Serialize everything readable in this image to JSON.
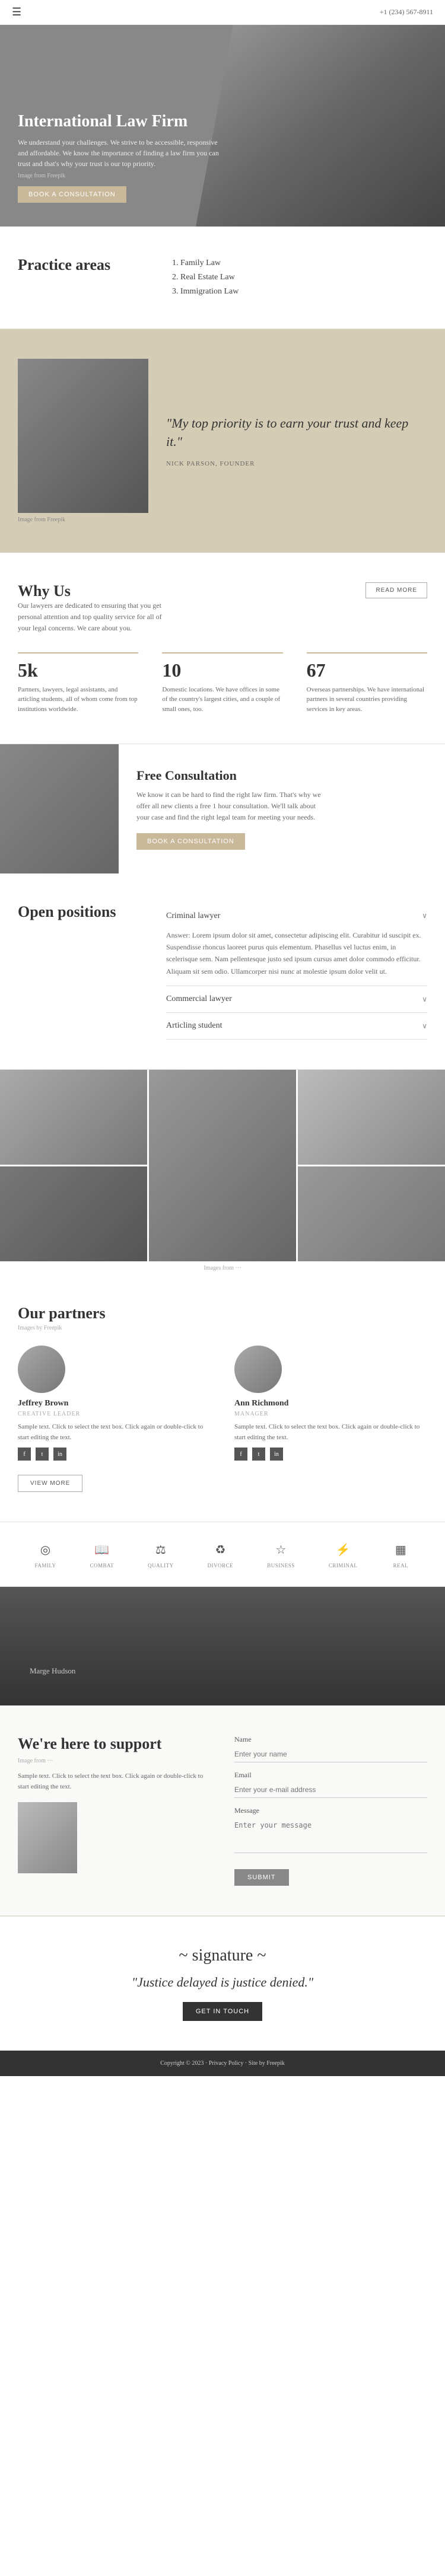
{
  "header": {
    "menu_icon": "☰",
    "phone": "+1 (234) 567-8911"
  },
  "hero": {
    "title": "International Law Firm",
    "description": "We understand your challenges. We strive to be accessible, responsive and affordable. We know the importance of finding a law firm you can trust and that's why your trust is our top priority.",
    "image_from": "Image from Freepik",
    "cta_label": "BOOK A CONSULTATION"
  },
  "practice": {
    "title": "Practice areas",
    "items": [
      "1. Family Law",
      "2. Real Estate Law",
      "3. Immigration Law"
    ]
  },
  "quote": {
    "text": "\"My top priority is to earn your trust and keep it.\"",
    "author": "NICK PARSON, FOUNDER",
    "image_from": "Image from Freepik"
  },
  "why_us": {
    "title": "Why Us",
    "description": "Our lawyers are dedicated to ensuring that you get personal attention and top quality service for all of your legal concerns. We care about you.",
    "read_more_label": "READ MORE",
    "stats": [
      {
        "number": "5k",
        "description": "Partners, lawyers, legal assistants, and articling students, all of whom come from top institutions worldwide."
      },
      {
        "number": "10",
        "description": "Domestic locations. We have offices in some of the country's largest cities, and a couple of small ones, too."
      },
      {
        "number": "67",
        "description": "Overseas partnerships. We have international partners in several countries providing services in key areas."
      }
    ]
  },
  "consultation": {
    "title": "Free Consultation",
    "description": "We know it can be hard to find the right law firm. That's why we offer all new clients a free 1 hour consultation. We'll talk about your case and find the right legal team for meeting your needs.",
    "cta_label": "BOOK A CONSULTATION"
  },
  "positions": {
    "title": "Open positions",
    "items": [
      {
        "label": "Criminal lawyer",
        "open": true,
        "body": "Answer: Lorem ipsum dolor sit amet, consectetur adipiscing elit. Curabitur id suscipit ex. Suspendisse rhoncus laoreet purus quis elementum. Phasellus vel luctus enim, in scelerisque sem. Nam pellentesque justo sed ipsum cursus amet dolor commodo efficitur. Aliquam sit sem odio. Ullamcorper nisi nunc at molestie ipsum dolor velit ut."
      },
      {
        "label": "Commercial lawyer",
        "open": false,
        "body": ""
      },
      {
        "label": "Articling student",
        "open": false,
        "body": ""
      }
    ]
  },
  "gallery": {
    "images_from": "Images from ···"
  },
  "partners": {
    "title": "Our partners",
    "images_from": "Images by Freepik",
    "people": [
      {
        "name": "Jeffrey Brown",
        "role": "CREATIVE LEADER",
        "description": "Sample text. Click to select the text box. Click again or double-click to start editing the text."
      },
      {
        "name": "Ann Richmond",
        "role": "MANAGER",
        "description": "Sample text. Click to select the text box. Click again or double-click to start editing the text."
      }
    ],
    "view_more_label": "VIEW MORE"
  },
  "icons_bar": {
    "items": [
      {
        "icon": "◎",
        "label": "FAMILY"
      },
      {
        "icon": "📖",
        "label": "COMBAT"
      },
      {
        "icon": "⚖",
        "label": "QUALITY"
      },
      {
        "icon": "♻",
        "label": "DIVORCE"
      },
      {
        "icon": "☆",
        "label": "BUSINESS"
      },
      {
        "icon": "⚡",
        "label": "CRIMINAL"
      },
      {
        "icon": "▦",
        "label": "REAL"
      }
    ]
  },
  "person_section": {
    "name": "Marge Hudson"
  },
  "support": {
    "title": "We're here to support",
    "image_from": "Image from ···",
    "description": "Sample text. Click to select the text box. Click again or double-click to start editing the text.",
    "form": {
      "name_label": "Name",
      "name_placeholder": "Enter your name",
      "email_label": "Email",
      "email_placeholder": "Enter your e-mail address",
      "message_label": "Message",
      "message_placeholder": "Enter your message",
      "submit_label": "SUBMIT"
    }
  },
  "quote_footer": {
    "signature": "~ signature ~",
    "text": "\"Justice delayed is justice denied.\"",
    "cta_label": "GET IN TOUCH"
  },
  "footer": {
    "text": "Copyright © 2023 · Privacy Policy · Site by Freepik"
  }
}
